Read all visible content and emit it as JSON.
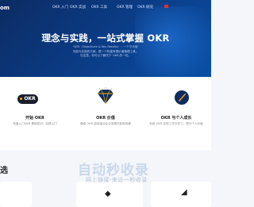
{
  "brand": {
    "logo_text": "om"
  },
  "nav": {
    "items": [
      "OKR 入门",
      "OKR 实战",
      "OKR 工具",
      "OKR 管理",
      "OKR 研究"
    ]
  },
  "hero": {
    "title": "理念与实践，一站式掌握 OKR",
    "text_lines": [
      "OKR（Objectives & Key Results）：一个又去使",
      "可能与实施的方案，是一个构建有限价值管理工具。",
      "在这里，你可以了解关于 OKR 的一切。"
    ]
  },
  "cards": [
    {
      "badge": "OKR",
      "title": "开始 OKR",
      "desc": "快速入门OKR 基础知识，实践入门"
    },
    {
      "title": "OKR 价值",
      "desc": "像被 OKR 如何驱动企业发展在各种场景"
    },
    {
      "title": "OKR 与个人成长",
      "desc": "利用 OKR 实现工作与学习，提升个人价值"
    }
  ],
  "section": {
    "title": "选"
  },
  "watermark": {
    "main": "自动秒收录",
    "sub": "网上链接·来访一秒收录"
  },
  "colors": {
    "hero_dark": "#0c2c63",
    "hero_light": "#0a4fa5",
    "accent": "#f5a623"
  },
  "icons": [
    "okr-badge-icon",
    "diamond-icon",
    "rocket-icon",
    "arrow-icon"
  ]
}
